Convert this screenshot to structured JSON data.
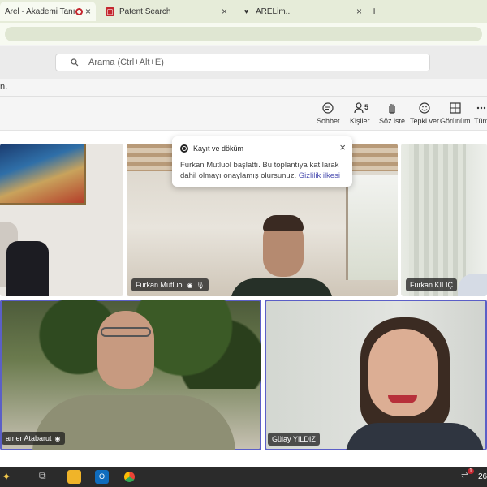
{
  "browser": {
    "tabs": [
      {
        "title": "Arel - Akademi Tanışma",
        "close": "×"
      },
      {
        "title": "Patent Search",
        "close": "×"
      },
      {
        "title": "ARELim..",
        "close": "×"
      }
    ],
    "new_tab": "+"
  },
  "teams": {
    "search_placeholder": "Arama (Ctrl+Alt+E)",
    "meeting_title_fragment": "n.",
    "controls": [
      {
        "label": "Sohbet",
        "icon": "chat-icon"
      },
      {
        "label": "Kişiler",
        "icon": "people-icon",
        "count": "5"
      },
      {
        "label": "Söz iste",
        "icon": "raise-hand-icon"
      },
      {
        "label": "Tepki ver",
        "icon": "react-icon"
      },
      {
        "label": "Görünüm",
        "icon": "view-icon"
      },
      {
        "label": "Tüm",
        "icon": "more-icon"
      }
    ]
  },
  "popup": {
    "title": "Kayıt ve döküm",
    "body": "Furkan Mutluol başlattı. Bu toplantıya katılarak dahil olmayı onaylamış olursunuz.",
    "link": "Gizlilik ilkesi",
    "close": "×"
  },
  "participants": [
    {
      "name": "Furkan Mutluol",
      "tile": "top-middle"
    },
    {
      "name": "Furkan KILIÇ",
      "tile": "top-right"
    },
    {
      "name": "amer Atabarut",
      "tile": "bottom-left"
    },
    {
      "name": "Gülay YILDIZ",
      "tile": "bottom-right"
    }
  ],
  "taskbar": {
    "clock_fragment": "26",
    "badge": "1"
  },
  "colors": {
    "accent": "#5b5fc7",
    "tabstrip": "#e6ecd9",
    "taskbar": "#2b2b2b"
  }
}
